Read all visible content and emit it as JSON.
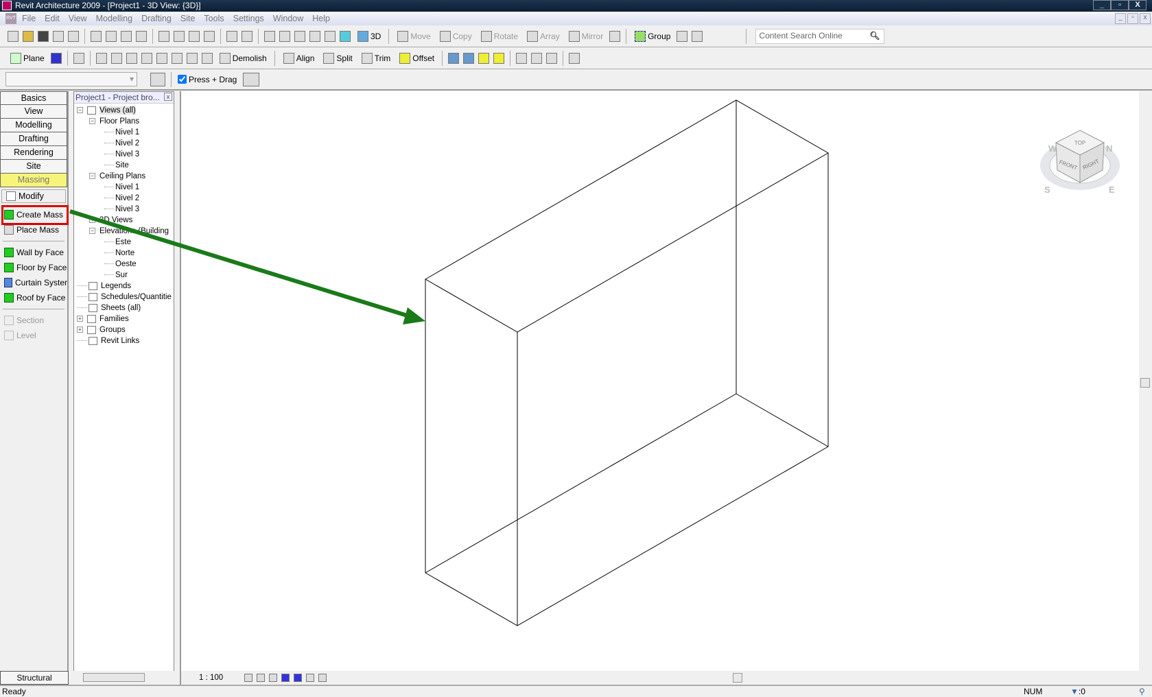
{
  "title": "Revit Architecture 2009 - [Project1 - 3D View: {3D}]",
  "window_buttons": [
    "_",
    "▫",
    "X"
  ],
  "menu": [
    "File",
    "Edit",
    "View",
    "Modelling",
    "Drafting",
    "Site",
    "Tools",
    "Settings",
    "Window",
    "Help"
  ],
  "toolbar1": {
    "view_3d": "3D",
    "move": "Move",
    "copy": "Copy",
    "rotate": "Rotate",
    "array": "Array",
    "mirror": "Mirror",
    "group": "Group",
    "search_placeholder": "Content Search Online"
  },
  "toolbar2": {
    "plane": "Plane",
    "demolish": "Demolish",
    "align": "Align",
    "split": "Split",
    "trim": "Trim",
    "offset": "Offset"
  },
  "toolbar3": {
    "press_drag": "Press + Drag"
  },
  "design_tabs": [
    "Basics",
    "View",
    "Modelling",
    "Drafting",
    "Rendering",
    "Site",
    "Massing"
  ],
  "design_items": {
    "modify": "Modify",
    "create_mass": "Create Mass",
    "place_mass": "Place Mass",
    "wall_by_face": "Wall by Face",
    "floor_by_face": "Floor by Face",
    "curtain_system": "Curtain Syster",
    "roof_by_face": "Roof by Face",
    "section": "Section",
    "level": "Level"
  },
  "structural_tab": "Structural",
  "browser": {
    "title": "Project1 - Project bro...",
    "tree": [
      "Views (all)",
      "Floor Plans",
      "Nivel 1",
      "Nivel 2",
      "Nivel 3",
      "Site",
      "Ceiling Plans",
      "Nivel 1",
      "Nivel 2",
      "Nivel 3",
      "3D Views",
      "Elevations (Building",
      "Este",
      "Norte",
      "Oeste",
      "Sur",
      "Legends",
      "Schedules/Quantitie",
      "Sheets (all)",
      "Families",
      "Groups",
      "Revit Links"
    ]
  },
  "viewcube": {
    "top": "TOP",
    "front": "FRONT",
    "right": "RIGHT",
    "n": "N",
    "s": "S",
    "e": "E",
    "w": "W"
  },
  "view_scale": "1 : 100",
  "status": {
    "text": "Ready",
    "num": "NUM",
    "filter_count": ":0"
  },
  "colors": {
    "highlight_box": "#e00000",
    "arrow": "#1a7a1a",
    "massing_tab": "#f6f57a"
  }
}
